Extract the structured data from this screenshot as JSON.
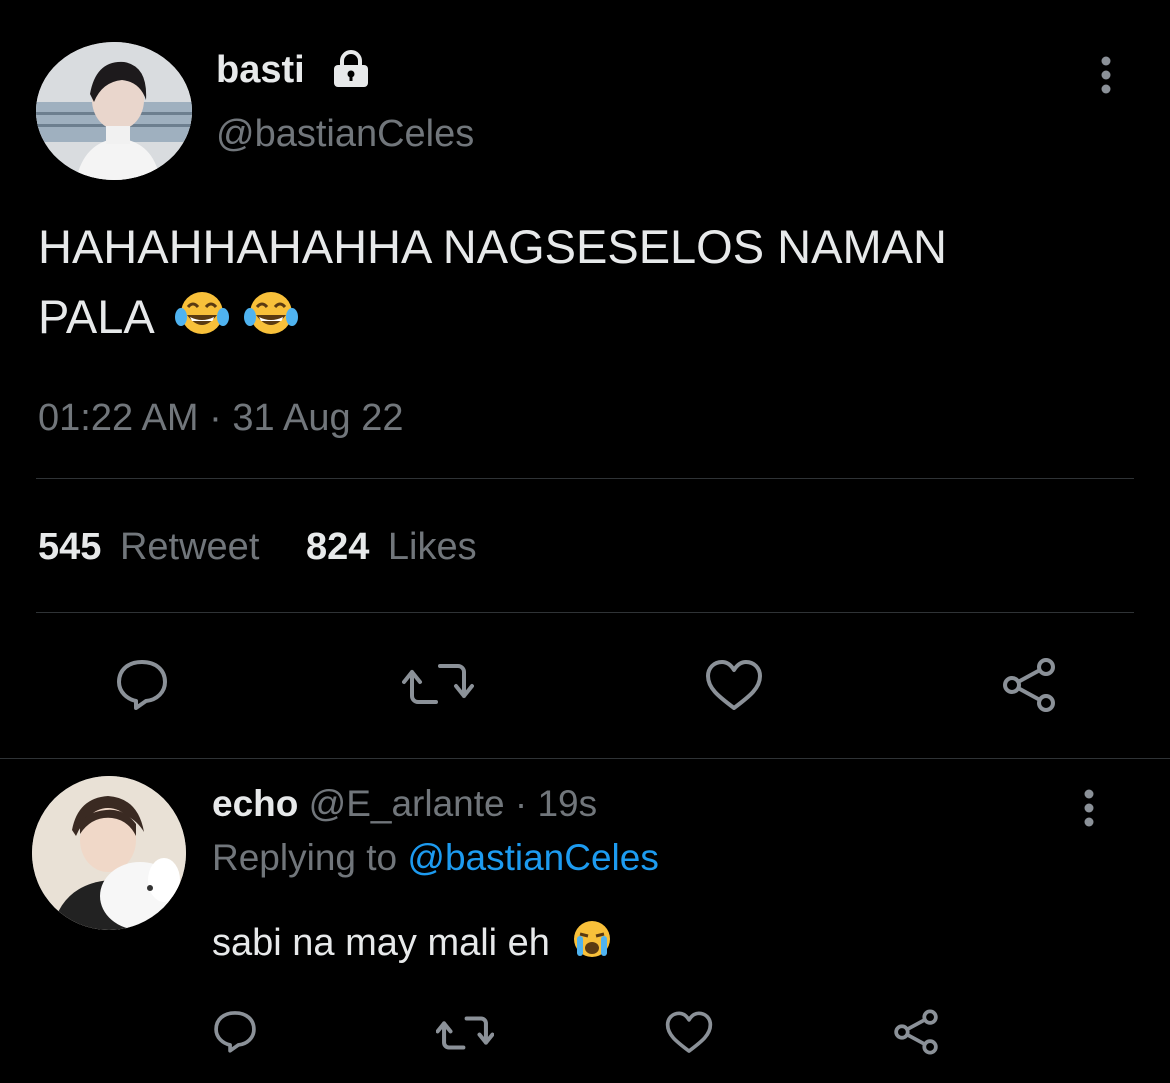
{
  "tweet": {
    "author_name": "basti",
    "author_handle": "@bastianCeles",
    "text_line1": "HAHAHHAHAHHA NAGSESELOS NAMAN",
    "text_line2": "PALA",
    "timestamp": "01:22 AM · 31 Aug 22",
    "retweet_count": "545",
    "retweet_label": "Retweet",
    "like_count": "824",
    "like_label": "Likes"
  },
  "reply": {
    "author_name": "echo",
    "author_handle": "@E_arlante",
    "time": "· 19s",
    "replying_prefix": "Replying to",
    "replying_to": "@bastianCeles",
    "text": "sabi na may mali eh"
  },
  "icons": {
    "lock": "lock-icon",
    "more": "more-vertical-icon",
    "reply": "reply-icon",
    "retweet": "retweet-icon",
    "like": "heart-icon",
    "share": "share-icon",
    "emoji_laugh": "tears-of-joy-emoji",
    "emoji_cry": "loudly-crying-emoji"
  },
  "colors": {
    "background": "#000000",
    "text": "#e7e9ea",
    "muted": "#71767b",
    "link": "#1d9bf0",
    "divider": "#2f3336"
  }
}
